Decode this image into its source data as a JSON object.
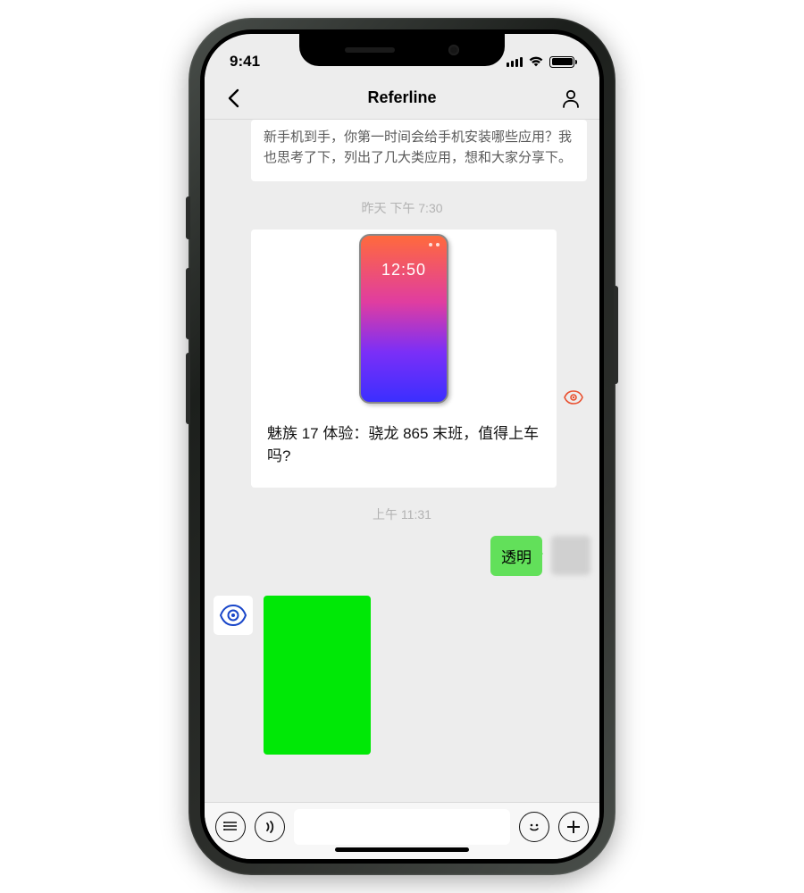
{
  "status": {
    "time": "9:41"
  },
  "nav": {
    "title": "Referline"
  },
  "messages": {
    "card_top_text": "新手机到手，你第一时间会给手机安装哪些应用？我也思考了下，列出了几大类应用，想和大家分享下。",
    "timestamp1": "昨天 下午 7:30",
    "article_caption": "魅族 17 体验：骁龙 865 末班，值得上车吗?",
    "mock_phone_time": "12:50",
    "timestamp2": "上午 11:31",
    "bubble_out_text": "透明"
  }
}
